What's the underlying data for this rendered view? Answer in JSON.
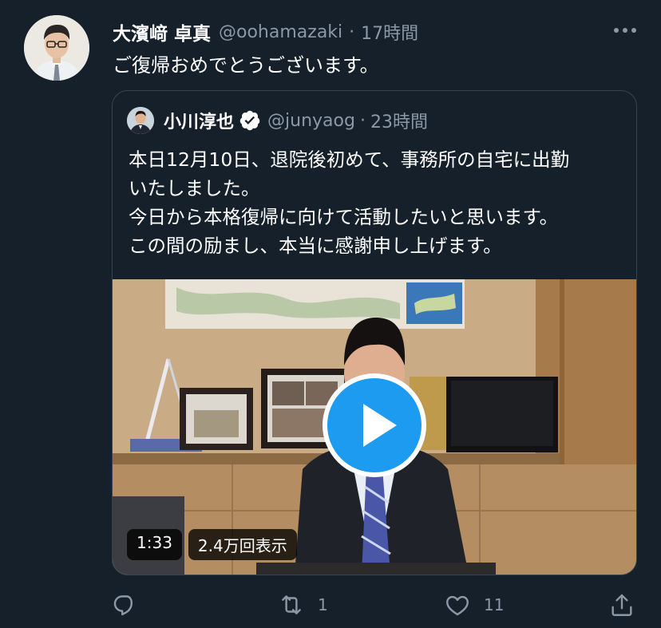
{
  "tweet": {
    "author_name": "大濱﨑 卓真",
    "author_handle": "@oohamazaki",
    "separator": "·",
    "time": "17時間",
    "text": "ご復帰おめでとうございます。"
  },
  "quote": {
    "author_name": "小川淳也",
    "author_handle": "@junyaog",
    "separator": "·",
    "time": "23時間",
    "text_lines": [
      "本日12月10日、退院後初めて、事務所の自宅に出勤",
      "いたしました。",
      "今日から本格復帰に向けて活動したいと思います。",
      "この間の励まし、本当に感謝申し上げます。"
    ],
    "video": {
      "duration": "1:33",
      "views": "2.4万回表示"
    }
  },
  "actions": {
    "reply_count": "",
    "retweet_count": "1",
    "like_count": "11"
  },
  "colors": {
    "background": "#15202b",
    "muted_text": "#8b98a5",
    "border": "#38444d",
    "verified": "#ffffff",
    "play_button": "#1d9bf0"
  },
  "icons": [
    "more-icon",
    "verified-badge-icon",
    "play-icon",
    "reply-icon",
    "retweet-icon",
    "like-icon",
    "share-icon"
  ]
}
